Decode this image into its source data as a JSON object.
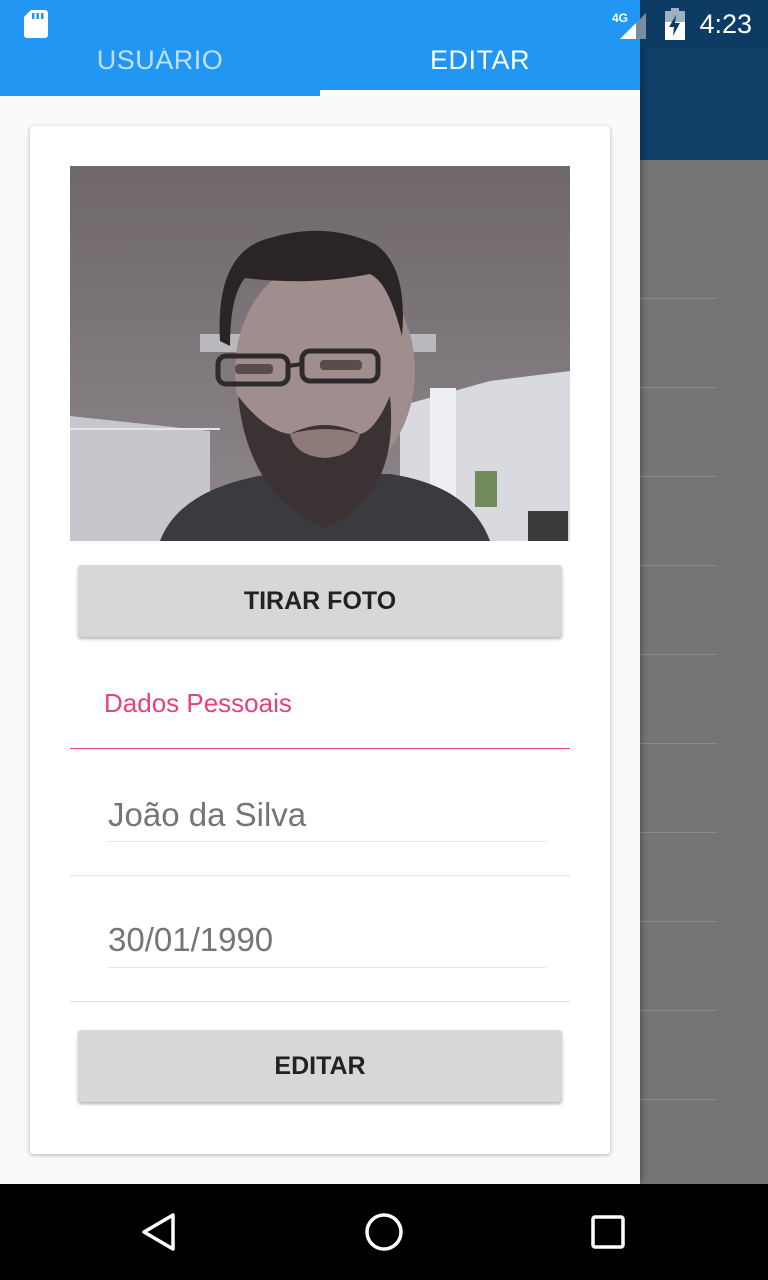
{
  "status_bar": {
    "time": "4:23",
    "network": "4G"
  },
  "tabs": [
    {
      "label": "USUÁRIO",
      "active": false
    },
    {
      "label": "EDITAR",
      "active": true
    }
  ],
  "form": {
    "take_photo_label": "TIRAR FOTO",
    "section_title": "Dados Pessoais",
    "name_placeholder": "João da Silva",
    "birthdate_placeholder": "30/01/1990",
    "submit_label": "EDITAR"
  },
  "colors": {
    "primary": "#2196f3",
    "accent": "#e8407d",
    "dark_primary": "#0d3b63"
  },
  "icons": {
    "sd_card": "sd-card-icon",
    "signal": "signal-icon",
    "battery": "battery-charging-icon",
    "nav_back": "back-triangle-icon",
    "nav_home": "home-circle-icon",
    "nav_recents": "recents-square-icon"
  }
}
